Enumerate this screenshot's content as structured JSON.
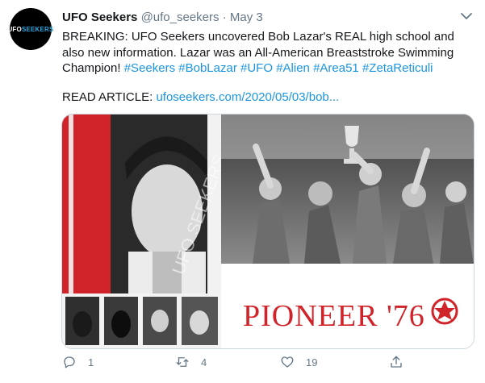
{
  "tweet": {
    "avatar_text": "UFO",
    "avatar_text_accent": "SEEKERS",
    "display_name": "UFO Seekers",
    "handle": "@ufo_seekers",
    "separator": "·",
    "date": "May 3",
    "text_main": "BREAKING: UFO Seekers uncovered Bob Lazar's REAL high school and also new information. Lazar was an All-American Breaststroke Swimming Champion!",
    "hashtags": [
      "#Seekers",
      "#BobLazar",
      "#UFO",
      "#Alien",
      "#Area51",
      "#ZetaReticuli"
    ],
    "read_label": "READ ARTICLE:",
    "link": "ufoseekers.com/2020/05/03/bob...",
    "image": {
      "yearbook_title": "PIONEER '76",
      "watermark": "UFO SEEKERS"
    }
  },
  "actions": {
    "reply_count": "1",
    "retweet_count": "4",
    "like_count": "19"
  },
  "colors": {
    "link": "#1b95e0",
    "muted": "#657786",
    "yearbook_red": "#d1232a"
  },
  "icons": [
    "chevron-down-icon",
    "reply-icon",
    "retweet-icon",
    "like-icon",
    "share-icon"
  ]
}
